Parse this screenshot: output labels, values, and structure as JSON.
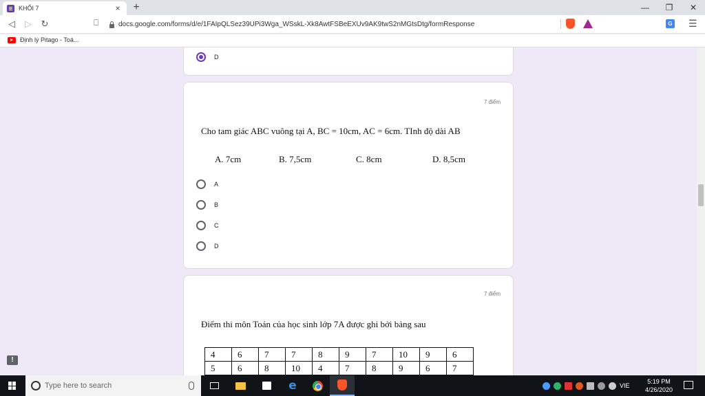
{
  "browser": {
    "tab_title": "KHỐI 7",
    "tab_close": "×",
    "new_tab": "+",
    "minimize": "—",
    "restore": "❐",
    "close": "✕",
    "url": "docs.google.com/forms/d/e/1FAIpQLSez39UPi3Wga_WSskL-Xk8AwtFSBeEXUv9AK9twS2nMGtsDtg/formResponse",
    "bookmark": "Định lý Pitago - Toá..."
  },
  "form": {
    "prev_option": "D",
    "q1": {
      "points": "7 điểm",
      "text": "Cho tam giác ABC vuông tại A, BC = 10cm, AC = 6cm. TInh độ dài AB",
      "answers": [
        "A. 7cm",
        "B. 7,5cm",
        "C. 8cm",
        "D. 8,5cm"
      ],
      "options": [
        "A",
        "B",
        "C",
        "D"
      ]
    },
    "q2": {
      "points": "7 điểm",
      "text": "Điểm thi môn Toán của học sinh lớp 7A được ghi bởi bảng sau",
      "table": [
        [
          "4",
          "6",
          "7",
          "7",
          "8",
          "9",
          "7",
          "10",
          "9",
          "6"
        ],
        [
          "5",
          "6",
          "8",
          "10",
          "4",
          "7",
          "8",
          "9",
          "6",
          "7"
        ]
      ]
    },
    "feedback": "!"
  },
  "taskbar": {
    "search_placeholder": "Type here to search",
    "language": "VIE",
    "time": "5:19 PM",
    "date": "4/26/2020"
  }
}
